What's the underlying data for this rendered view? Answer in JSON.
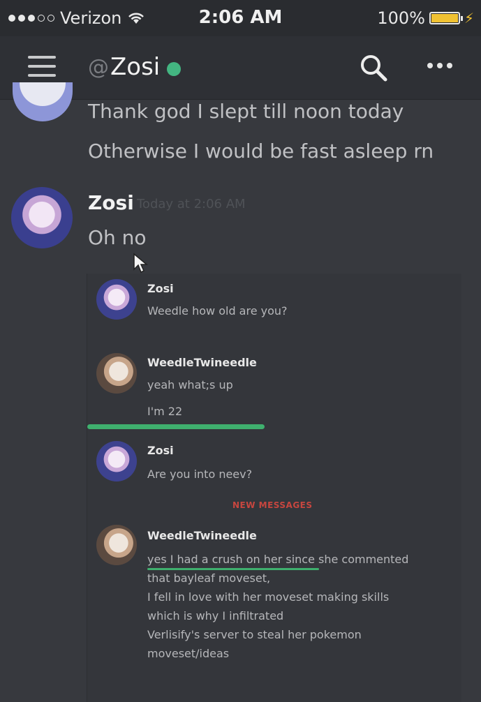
{
  "status_bar": {
    "carrier": "Verizon",
    "time": "2:06 AM",
    "battery": "100%"
  },
  "header": {
    "at": "@",
    "channel_name": "Zosi",
    "status_color": "#43b581"
  },
  "messages": {
    "previous_lines": [
      "Thank god I slept till noon today",
      "Otherwise I would be fast asleep rn"
    ],
    "current": {
      "author": "Zosi",
      "timestamp": "Today at 2:06 AM",
      "text": "Oh no"
    }
  },
  "screenshot": {
    "m1": {
      "author": "Zosi",
      "text": "Weedle how old are you?"
    },
    "m2": {
      "author": "WeedleTwineedle",
      "lines": [
        "yeah what;s up",
        "I'm 22"
      ]
    },
    "m3": {
      "author": "Zosi",
      "text": "Are you into neev?"
    },
    "new_messages_label": "NEW MESSAGES",
    "m4": {
      "author": "WeedleTwineedle",
      "lines": [
        "yes I had a crush on her since she commented",
        "that bayleaf moveset,",
        "I fell in love with her moveset making skills",
        "which is why I infiltrated",
        "Verlisify's server to steal her  pokemon",
        "moveset/ideas"
      ]
    }
  },
  "colors": {
    "background": "#37393e",
    "header": "#2e3035",
    "highlight_green": "#3fb06e",
    "new_messages_red": "#c7463f",
    "battery_yellow": "#f1c232"
  },
  "icons": [
    "menu-icon",
    "search-icon",
    "more-icon",
    "wifi-icon",
    "battery-icon",
    "cursor-icon"
  ]
}
